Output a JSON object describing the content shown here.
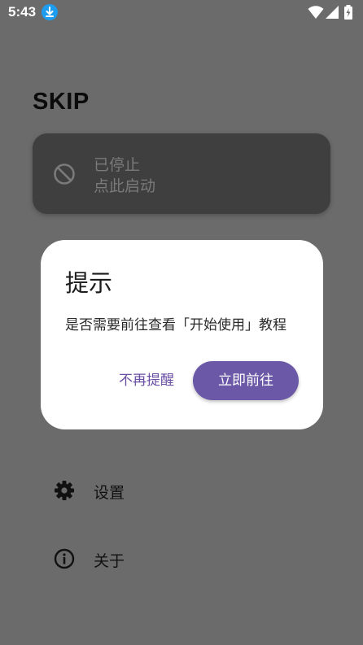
{
  "status_bar": {
    "time": "5:43",
    "icons": [
      "download-icon",
      "wifi-icon",
      "cell-signal-icon",
      "battery-icon"
    ]
  },
  "app": {
    "title": "SKIP"
  },
  "status_card": {
    "icon": "block-icon",
    "line1": "已停止",
    "line2": "点此启动"
  },
  "menu": {
    "settings_label": "设置",
    "about_label": "关于"
  },
  "dialog": {
    "title": "提示",
    "message": "是否需要前往查看「开始使用」教程",
    "dismiss_label": "不再提醒",
    "confirm_label": "立即前往"
  },
  "colors": {
    "scrim_background": "#6b6b6b",
    "card_background": "#3f3f3f",
    "accent": "#6b58a7",
    "dialog_background": "#ffffff"
  }
}
